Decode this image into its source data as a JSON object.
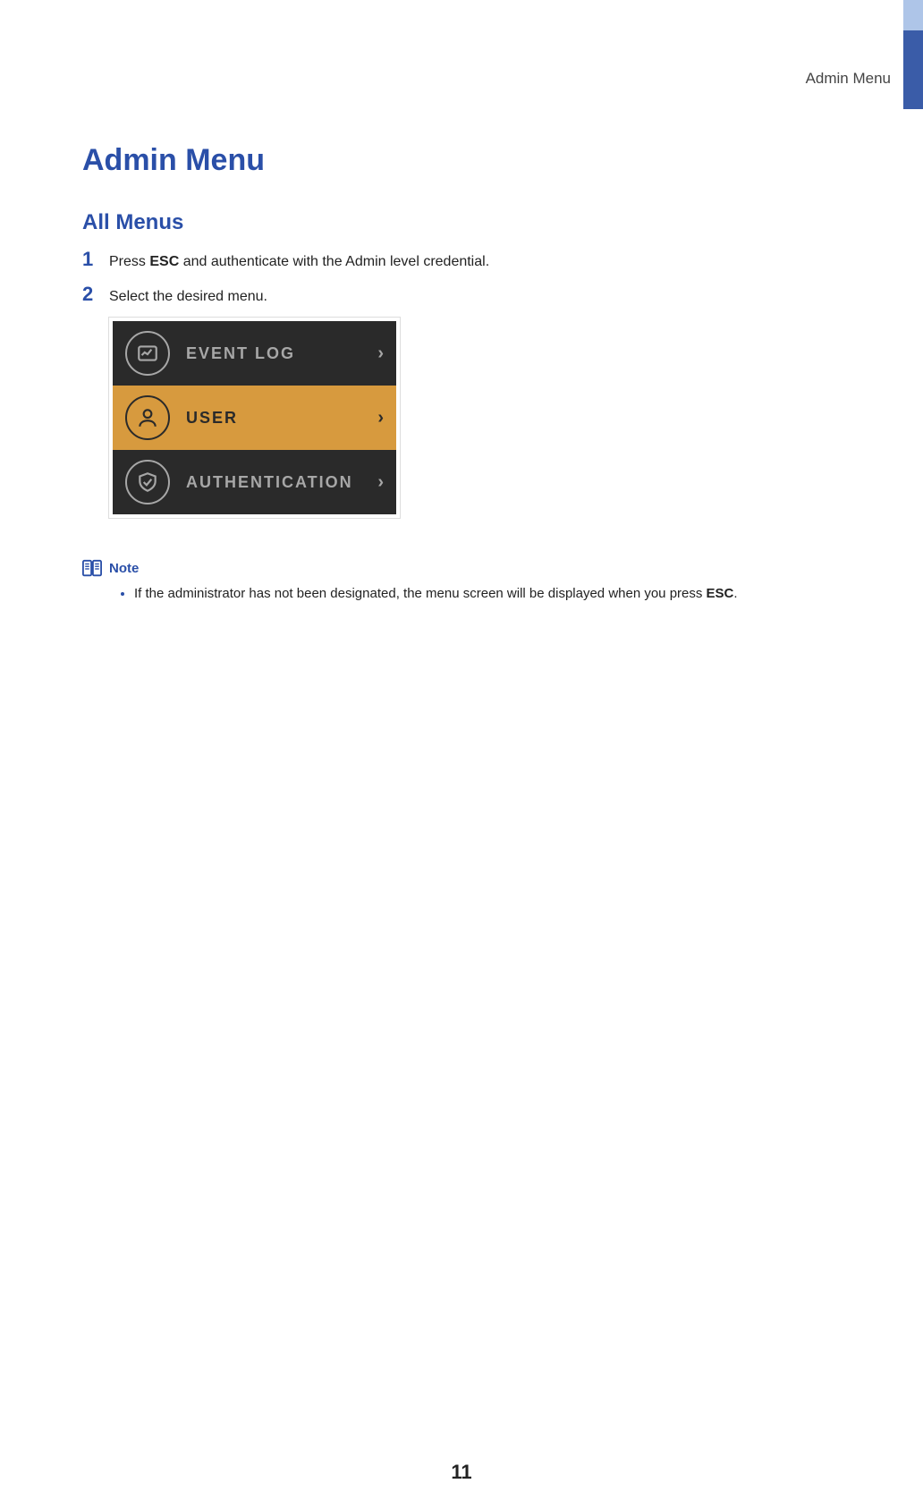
{
  "header": {
    "section": "Admin  Menu"
  },
  "main": {
    "h1": "Admin Menu",
    "h2": "All Menus",
    "steps": [
      {
        "num": "1",
        "prefix": "Press ",
        "key": "ESC",
        "suffix": " and authenticate with the Admin level credential."
      },
      {
        "num": "2",
        "text": "Select the desired menu."
      }
    ],
    "device_menu": {
      "items": [
        {
          "label": "EVENT LOG",
          "icon": "eventlog-icon",
          "chevron": "›"
        },
        {
          "label": "USER",
          "icon": "user-icon",
          "chevron": "›",
          "selected": true
        },
        {
          "label": "AUTHENTICATION",
          "icon": "auth-icon",
          "chevron": "›"
        }
      ]
    }
  },
  "note": {
    "title": "Note",
    "items": [
      {
        "prefix": "If the administrator has not been designated, the menu screen will be displayed when you press ",
        "key": "ESC",
        "suffix": "."
      }
    ]
  },
  "footer": {
    "page_number": "11"
  }
}
